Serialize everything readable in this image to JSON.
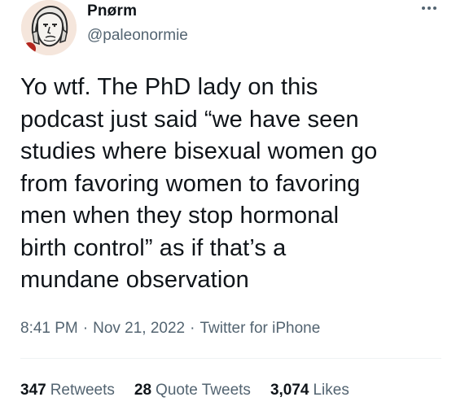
{
  "author": {
    "display_name": "Pnørm",
    "handle": "@paleonormie",
    "avatar_icon": "wojak-helmet-avatar"
  },
  "tweet": {
    "text": "Yo wtf. The PhD lady on this\npodcast just said “we have seen\nstudies where bisexual women go\nfrom favoring women to favoring\nmen when they stop hormonal\nbirth control” as if that’s a\nmundane observation",
    "time": "8:41 PM",
    "date": "Nov 21, 2022",
    "source": "Twitter for iPhone",
    "separator": "·"
  },
  "stats": {
    "retweets": {
      "count": "347",
      "label": "Retweets"
    },
    "quotes": {
      "count": "28",
      "label": "Quote Tweets"
    },
    "likes": {
      "count": "3,074",
      "label": "Likes"
    }
  },
  "menu": {
    "icon": "more-dots-icon"
  },
  "colors": {
    "text_primary": "#0f1419",
    "text_secondary": "#536471",
    "divider": "#eff3f4",
    "background": "#ffffff"
  }
}
